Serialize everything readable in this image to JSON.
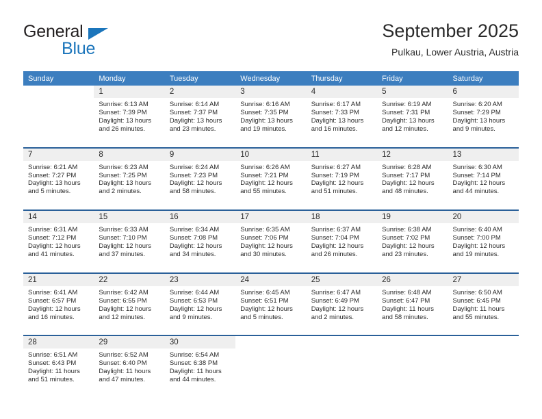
{
  "brand": {
    "word_one": "General",
    "word_two": "Blue",
    "triangle_icon": "triangle-icon",
    "accent_color": "#1b75bb"
  },
  "header": {
    "title": "September 2025",
    "subtitle": "Pulkau, Lower Austria, Austria"
  },
  "theme": {
    "header_blue": "#3c7ebf",
    "row_divider_blue": "#2a6099",
    "date_strip_gray": "#efefef",
    "text_color": "#2a2a2a"
  },
  "weekdays": [
    "Sunday",
    "Monday",
    "Tuesday",
    "Wednesday",
    "Thursday",
    "Friday",
    "Saturday"
  ],
  "weeks": [
    [
      {
        "day": "",
        "lines": []
      },
      {
        "day": "1",
        "lines": [
          "Sunrise: 6:13 AM",
          "Sunset: 7:39 PM",
          "Daylight: 13 hours",
          "and 26 minutes."
        ]
      },
      {
        "day": "2",
        "lines": [
          "Sunrise: 6:14 AM",
          "Sunset: 7:37 PM",
          "Daylight: 13 hours",
          "and 23 minutes."
        ]
      },
      {
        "day": "3",
        "lines": [
          "Sunrise: 6:16 AM",
          "Sunset: 7:35 PM",
          "Daylight: 13 hours",
          "and 19 minutes."
        ]
      },
      {
        "day": "4",
        "lines": [
          "Sunrise: 6:17 AM",
          "Sunset: 7:33 PM",
          "Daylight: 13 hours",
          "and 16 minutes."
        ]
      },
      {
        "day": "5",
        "lines": [
          "Sunrise: 6:19 AM",
          "Sunset: 7:31 PM",
          "Daylight: 13 hours",
          "and 12 minutes."
        ]
      },
      {
        "day": "6",
        "lines": [
          "Sunrise: 6:20 AM",
          "Sunset: 7:29 PM",
          "Daylight: 13 hours",
          "and 9 minutes."
        ]
      }
    ],
    [
      {
        "day": "7",
        "lines": [
          "Sunrise: 6:21 AM",
          "Sunset: 7:27 PM",
          "Daylight: 13 hours",
          "and 5 minutes."
        ]
      },
      {
        "day": "8",
        "lines": [
          "Sunrise: 6:23 AM",
          "Sunset: 7:25 PM",
          "Daylight: 13 hours",
          "and 2 minutes."
        ]
      },
      {
        "day": "9",
        "lines": [
          "Sunrise: 6:24 AM",
          "Sunset: 7:23 PM",
          "Daylight: 12 hours",
          "and 58 minutes."
        ]
      },
      {
        "day": "10",
        "lines": [
          "Sunrise: 6:26 AM",
          "Sunset: 7:21 PM",
          "Daylight: 12 hours",
          "and 55 minutes."
        ]
      },
      {
        "day": "11",
        "lines": [
          "Sunrise: 6:27 AM",
          "Sunset: 7:19 PM",
          "Daylight: 12 hours",
          "and 51 minutes."
        ]
      },
      {
        "day": "12",
        "lines": [
          "Sunrise: 6:28 AM",
          "Sunset: 7:17 PM",
          "Daylight: 12 hours",
          "and 48 minutes."
        ]
      },
      {
        "day": "13",
        "lines": [
          "Sunrise: 6:30 AM",
          "Sunset: 7:14 PM",
          "Daylight: 12 hours",
          "and 44 minutes."
        ]
      }
    ],
    [
      {
        "day": "14",
        "lines": [
          "Sunrise: 6:31 AM",
          "Sunset: 7:12 PM",
          "Daylight: 12 hours",
          "and 41 minutes."
        ]
      },
      {
        "day": "15",
        "lines": [
          "Sunrise: 6:33 AM",
          "Sunset: 7:10 PM",
          "Daylight: 12 hours",
          "and 37 minutes."
        ]
      },
      {
        "day": "16",
        "lines": [
          "Sunrise: 6:34 AM",
          "Sunset: 7:08 PM",
          "Daylight: 12 hours",
          "and 34 minutes."
        ]
      },
      {
        "day": "17",
        "lines": [
          "Sunrise: 6:35 AM",
          "Sunset: 7:06 PM",
          "Daylight: 12 hours",
          "and 30 minutes."
        ]
      },
      {
        "day": "18",
        "lines": [
          "Sunrise: 6:37 AM",
          "Sunset: 7:04 PM",
          "Daylight: 12 hours",
          "and 26 minutes."
        ]
      },
      {
        "day": "19",
        "lines": [
          "Sunrise: 6:38 AM",
          "Sunset: 7:02 PM",
          "Daylight: 12 hours",
          "and 23 minutes."
        ]
      },
      {
        "day": "20",
        "lines": [
          "Sunrise: 6:40 AM",
          "Sunset: 7:00 PM",
          "Daylight: 12 hours",
          "and 19 minutes."
        ]
      }
    ],
    [
      {
        "day": "21",
        "lines": [
          "Sunrise: 6:41 AM",
          "Sunset: 6:57 PM",
          "Daylight: 12 hours",
          "and 16 minutes."
        ]
      },
      {
        "day": "22",
        "lines": [
          "Sunrise: 6:42 AM",
          "Sunset: 6:55 PM",
          "Daylight: 12 hours",
          "and 12 minutes."
        ]
      },
      {
        "day": "23",
        "lines": [
          "Sunrise: 6:44 AM",
          "Sunset: 6:53 PM",
          "Daylight: 12 hours",
          "and 9 minutes."
        ]
      },
      {
        "day": "24",
        "lines": [
          "Sunrise: 6:45 AM",
          "Sunset: 6:51 PM",
          "Daylight: 12 hours",
          "and 5 minutes."
        ]
      },
      {
        "day": "25",
        "lines": [
          "Sunrise: 6:47 AM",
          "Sunset: 6:49 PM",
          "Daylight: 12 hours",
          "and 2 minutes."
        ]
      },
      {
        "day": "26",
        "lines": [
          "Sunrise: 6:48 AM",
          "Sunset: 6:47 PM",
          "Daylight: 11 hours",
          "and 58 minutes."
        ]
      },
      {
        "day": "27",
        "lines": [
          "Sunrise: 6:50 AM",
          "Sunset: 6:45 PM",
          "Daylight: 11 hours",
          "and 55 minutes."
        ]
      }
    ],
    [
      {
        "day": "28",
        "lines": [
          "Sunrise: 6:51 AM",
          "Sunset: 6:43 PM",
          "Daylight: 11 hours",
          "and 51 minutes."
        ]
      },
      {
        "day": "29",
        "lines": [
          "Sunrise: 6:52 AM",
          "Sunset: 6:40 PM",
          "Daylight: 11 hours",
          "and 47 minutes."
        ]
      },
      {
        "day": "30",
        "lines": [
          "Sunrise: 6:54 AM",
          "Sunset: 6:38 PM",
          "Daylight: 11 hours",
          "and 44 minutes."
        ]
      },
      {
        "day": "",
        "lines": []
      },
      {
        "day": "",
        "lines": []
      },
      {
        "day": "",
        "lines": []
      },
      {
        "day": "",
        "lines": []
      }
    ]
  ]
}
